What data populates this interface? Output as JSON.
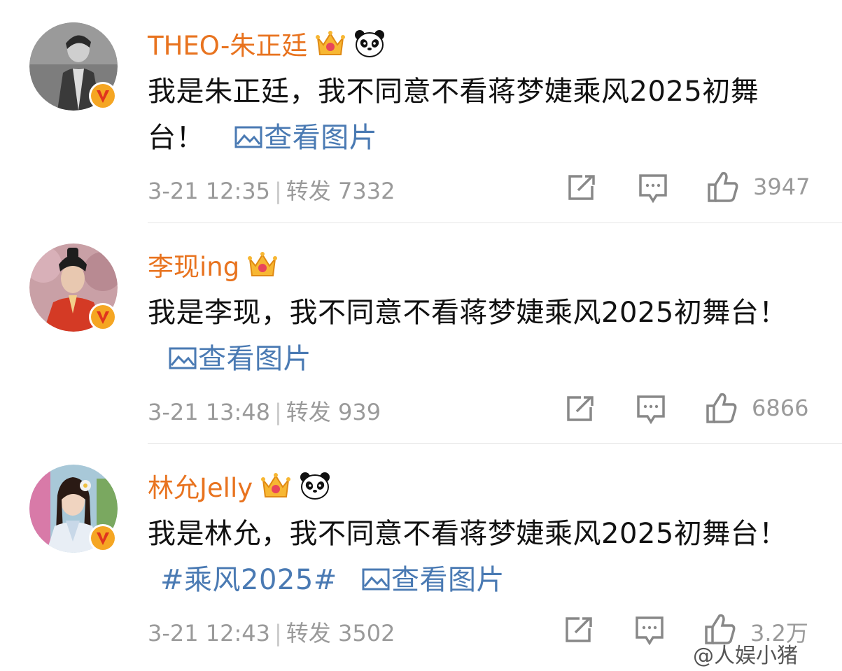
{
  "comments": [
    {
      "username": "THEO-朱正廷",
      "has_panda": true,
      "text": "我是朱正廷，我不同意不看蒋梦婕乘风2025初舞台！",
      "hashtag": "",
      "view_image": "查看图片",
      "time": "3-21 12:35",
      "repost_label": "转发",
      "repost_count": "7332",
      "like_count": "3947"
    },
    {
      "username": "李现ing",
      "has_panda": false,
      "text": "我是李现，我不同意不看蒋梦婕乘风2025初舞台！",
      "hashtag": "",
      "view_image": "查看图片",
      "time": "3-21 13:48",
      "repost_label": "转发",
      "repost_count": "939",
      "like_count": "6866"
    },
    {
      "username": "林允Jelly",
      "has_panda": true,
      "text": "我是林允，我不同意不看蒋梦婕乘风2025初舞台！",
      "hashtag": "#乘风2025#",
      "view_image": "查看图片",
      "time": "3-21 12:43",
      "repost_label": "转发",
      "repost_count": "3502",
      "like_count": "3.2万"
    }
  ],
  "watermark": "@人娱小猪",
  "colors": {
    "username": "#e8731f",
    "link": "#4a7ab3",
    "meta": "#9a9a9a",
    "verified_badge": "#f5a623"
  },
  "icons": {
    "verified": "verified-v-icon",
    "crown": "crown-badge-icon",
    "panda": "panda-icon",
    "image": "image-icon",
    "share": "share-icon",
    "comment": "comment-icon",
    "like": "thumbs-up-icon"
  }
}
